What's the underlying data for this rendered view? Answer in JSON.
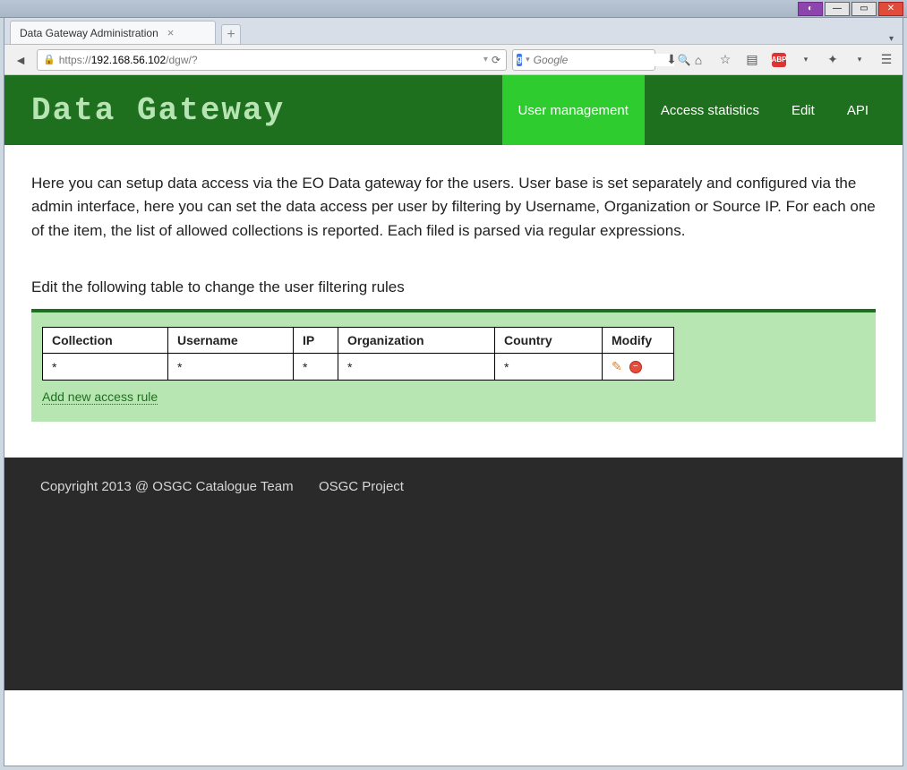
{
  "window": {
    "tab_title": "Data Gateway Administration"
  },
  "url": {
    "scheme": "https://",
    "host": "192.168.56.102",
    "path": "/dgw/?"
  },
  "search": {
    "placeholder": "Google"
  },
  "header": {
    "brand": "Data Gateway",
    "nav": {
      "user_mgmt": "User management",
      "access_stats": "Access statistics",
      "edit": "Edit",
      "api": "API"
    }
  },
  "content": {
    "intro": "Here you can setup data access via the EO Data gateway for the users. User base is set separately and configured via the admin interface, here you can set the data access per user by filtering by Username, Organization or Source IP. For each one of the item, the list of allowed collections is reported. Each filed is parsed via regular expressions.",
    "subhead": "Edit the following table to change the user filtering rules",
    "columns": {
      "collection": "Collection",
      "username": "Username",
      "ip": "IP",
      "organization": "Organization",
      "country": "Country",
      "modify": "Modify"
    },
    "rows": [
      {
        "collection": "*",
        "username": "*",
        "ip": "*",
        "organization": "*",
        "country": "*"
      }
    ],
    "add_link": "Add new access rule"
  },
  "footer": {
    "copyright": "Copyright 2013 @ OSGC Catalogue Team",
    "project": "OSGC Project"
  }
}
